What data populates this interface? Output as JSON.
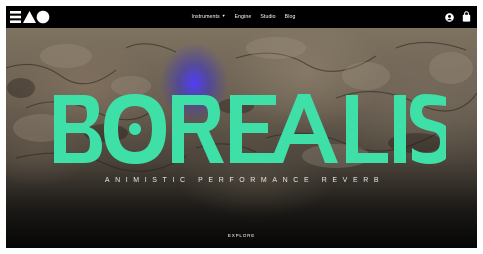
{
  "nav": {
    "brand": "EAO",
    "links": [
      {
        "label": "Instruments",
        "has_dropdown": true
      },
      {
        "label": "Engine"
      },
      {
        "label": "Studio"
      },
      {
        "label": "Blog"
      }
    ],
    "icons": [
      "account-icon",
      "cart-icon"
    ]
  },
  "hero": {
    "title": "BOREALIS",
    "subtitle": "ANIMISTIC PERFORMANCE REVERB",
    "cta": "EXPLORE",
    "title_color": "#3ee0a8",
    "glow_color": "#4b3cff"
  }
}
